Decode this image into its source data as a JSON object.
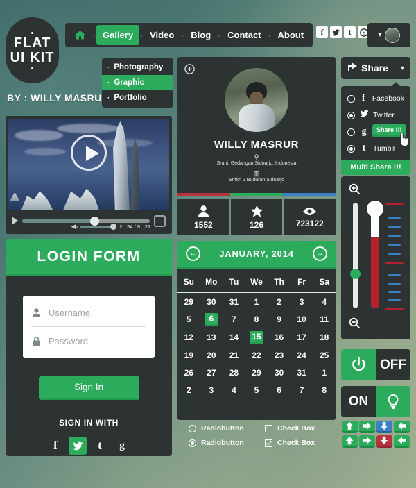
{
  "logo": {
    "line1": "FLAT",
    "line2": "UI KIT"
  },
  "byline": "BY : WILLY MASRUR",
  "nav": {
    "home_icon": "home-icon",
    "items": [
      {
        "label": "Gallery",
        "active": true
      },
      {
        "label": "Video",
        "active": false
      },
      {
        "label": "Blog",
        "active": false
      },
      {
        "label": "Contact",
        "active": false
      },
      {
        "label": "About",
        "active": false
      }
    ],
    "separator": "·",
    "social": [
      "f",
      "t",
      "t",
      "s"
    ],
    "social_names": [
      "facebook-icon",
      "twitter-icon",
      "tumblr-icon",
      "skype-icon"
    ],
    "avatar_chevron": "▾"
  },
  "dropdown": {
    "bullet": "·",
    "items": [
      {
        "label": "Photography",
        "active": false
      },
      {
        "label": "Graphic",
        "active": true
      },
      {
        "label": "Portfolio",
        "active": false
      }
    ]
  },
  "video": {
    "time": "2 : 54 / 5 : 21"
  },
  "login": {
    "title": "LOGIN FORM",
    "username_placeholder": "Username",
    "password_placeholder": "Password",
    "signin_label": "Sign In",
    "signin_with_label": "SIGN IN WITH",
    "socials": [
      {
        "glyph": "f",
        "name": "facebook-icon",
        "active": false
      },
      {
        "glyph": "t",
        "name": "twitter-icon",
        "active": true
      },
      {
        "glyph": "t",
        "name": "tumblr-icon",
        "active": false
      },
      {
        "glyph": "g",
        "name": "google-plus-icon",
        "active": false
      }
    ]
  },
  "profile": {
    "name": "WILLY MASRUR",
    "location": "Sruni, Gedangan Sidoarjo, Indonesia",
    "school": "Smkn 2 Buduran Sidoarjo",
    "location_icon": "map-pin-icon",
    "school_icon": "book-icon",
    "add_icon": "plus-circle-icon",
    "bar_colors": [
      "#b3343f",
      "#2dab5c",
      "#3b7fc4"
    ]
  },
  "stats": [
    {
      "icon": "person-icon",
      "value": "1552"
    },
    {
      "icon": "star-icon",
      "value": "126"
    },
    {
      "icon": "eye-icon",
      "value": "723122"
    }
  ],
  "calendar": {
    "title": "JANUARY, 2014",
    "prev_icon": "arrow-left-circle-icon",
    "next_icon": "arrow-right-circle-icon",
    "weekdays": [
      "Su",
      "Mo",
      "Tu",
      "We",
      "Th",
      "Fr",
      "Sa"
    ],
    "weeks": [
      [
        {
          "d": "29"
        },
        {
          "d": "30"
        },
        {
          "d": "31"
        },
        {
          "d": "1"
        },
        {
          "d": "2"
        },
        {
          "d": "3"
        },
        {
          "d": "4"
        }
      ],
      [
        {
          "d": "5"
        },
        {
          "d": "6",
          "sel": true
        },
        {
          "d": "7"
        },
        {
          "d": "8"
        },
        {
          "d": "9"
        },
        {
          "d": "10"
        },
        {
          "d": "11"
        }
      ],
      [
        {
          "d": "12"
        },
        {
          "d": "13"
        },
        {
          "d": "14"
        },
        {
          "d": "15",
          "sel": true
        },
        {
          "d": "16"
        },
        {
          "d": "17"
        },
        {
          "d": "18"
        }
      ],
      [
        {
          "d": "19"
        },
        {
          "d": "20"
        },
        {
          "d": "21"
        },
        {
          "d": "22"
        },
        {
          "d": "23"
        },
        {
          "d": "24"
        },
        {
          "d": "25"
        }
      ],
      [
        {
          "d": "26"
        },
        {
          "d": "27"
        },
        {
          "d": "28"
        },
        {
          "d": "29"
        },
        {
          "d": "30"
        },
        {
          "d": "31"
        },
        {
          "d": "1"
        }
      ],
      [
        {
          "d": "2"
        },
        {
          "d": "3"
        },
        {
          "d": "4"
        },
        {
          "d": "5"
        },
        {
          "d": "6"
        },
        {
          "d": "7"
        },
        {
          "d": "8"
        }
      ]
    ]
  },
  "controls": {
    "radio1": "Radiobutton",
    "radio2": "Radiobutton",
    "check1": "Check Box",
    "check2": "Check Box"
  },
  "share": {
    "button_label": "Share",
    "button_icon": "share-icon",
    "chevron": "▾",
    "options": [
      {
        "label": "Facebook",
        "glyph": "f",
        "icon": "facebook-icon",
        "checked": false
      },
      {
        "label": "Twitter",
        "glyph": "t",
        "icon": "twitter-icon",
        "checked": true
      },
      {
        "label": "",
        "glyph": "g",
        "icon": "google-plus-icon",
        "checked": false
      },
      {
        "label": "Tumblr",
        "glyph": "t",
        "icon": "tumblr-icon",
        "checked": true
      }
    ],
    "tooltip": "Share !!!",
    "multi_label": "Multi Share !!!"
  },
  "slider": {
    "zoom_in_icon": "zoom-in-icon",
    "zoom_out_icon": "zoom-out-icon",
    "thermometer_icon": "thermometer-icon"
  },
  "toggles": {
    "power_icon": "power-icon",
    "off_label": "OFF",
    "on_label": "ON",
    "bulb_icon": "lightbulb-icon"
  },
  "arrows": [
    {
      "dir": "up",
      "color": "g"
    },
    {
      "dir": "right",
      "color": "g"
    },
    {
      "dir": "down",
      "color": "b"
    },
    {
      "dir": "left",
      "color": "g"
    },
    {
      "dir": "up",
      "color": "g"
    },
    {
      "dir": "right",
      "color": "g"
    },
    {
      "dir": "down",
      "color": "r"
    },
    {
      "dir": "left",
      "color": "g"
    }
  ],
  "colors": {
    "green": "#2dab5c",
    "dark": "#2d3233",
    "blue": "#3b7fc4",
    "red": "#b3343f"
  }
}
